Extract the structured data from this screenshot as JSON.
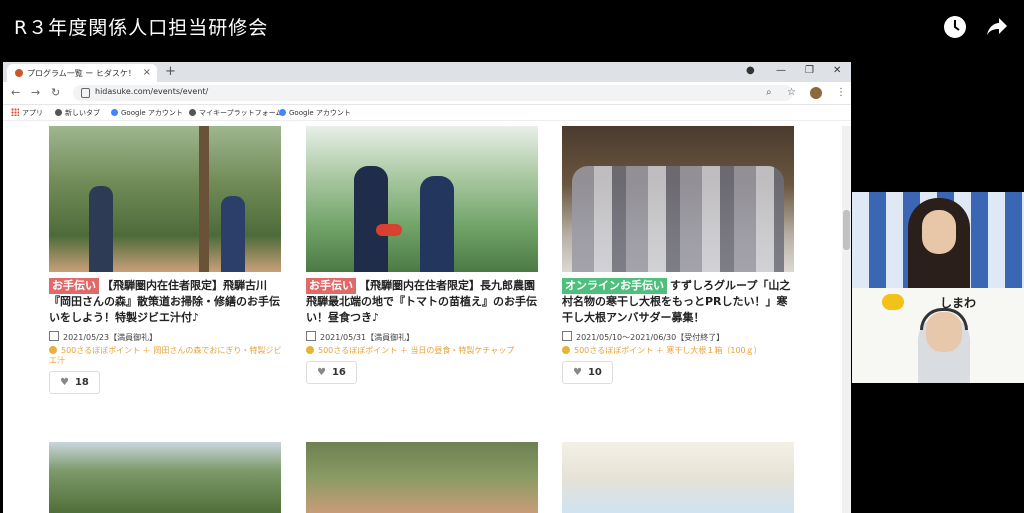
{
  "video": {
    "title": "R３年度関係人口担当研修会"
  },
  "browser": {
    "tab_title": "プログラム一覧 ー ヒダスケ！",
    "url": "hidasuke.com/events/event/",
    "bookmarks": [
      "アプリ",
      "新しいタブ",
      "Google アカウント",
      "マイキープラットフォーム",
      "Google アカウント"
    ]
  },
  "cards": [
    {
      "badge": "お手伝い",
      "title": "【飛騨圏内在住者限定】飛騨古川『岡田さんの森』散策道お掃除・修繕のお手伝いをしよう！特製ジビエ汁付♪",
      "date": "2021/05/23【満員御礼】",
      "points": "500さるぼぼポイント ＋ 岡田さんの森でおにぎり・特製ジビエ汁",
      "likes": "18"
    },
    {
      "badge": "お手伝い",
      "title": "【飛騨圏内在住者限定】長九郎農園飛騨最北端の地で『トマトの苗植え』のお手伝い！昼食つき♪",
      "date": "2021/05/31【満員御礼】",
      "points": "500さるぼぼポイント ＋ 当日の昼食・特製ケチャップ",
      "likes": "16"
    },
    {
      "badge": "オンラインお手伝い",
      "title": "すずしろグループ「山之村名物の寒干し大根をもっとPRしたい！」寒干し大根アンバサダー募集！",
      "date": "2021/05/10〜2021/06/30【受付終了】",
      "points": "500さるぼぼポイント ＋ 寒干し大根１箱（100ｇ）",
      "likes": "10"
    }
  ],
  "webcam": {
    "logo_text": "しまわ"
  }
}
